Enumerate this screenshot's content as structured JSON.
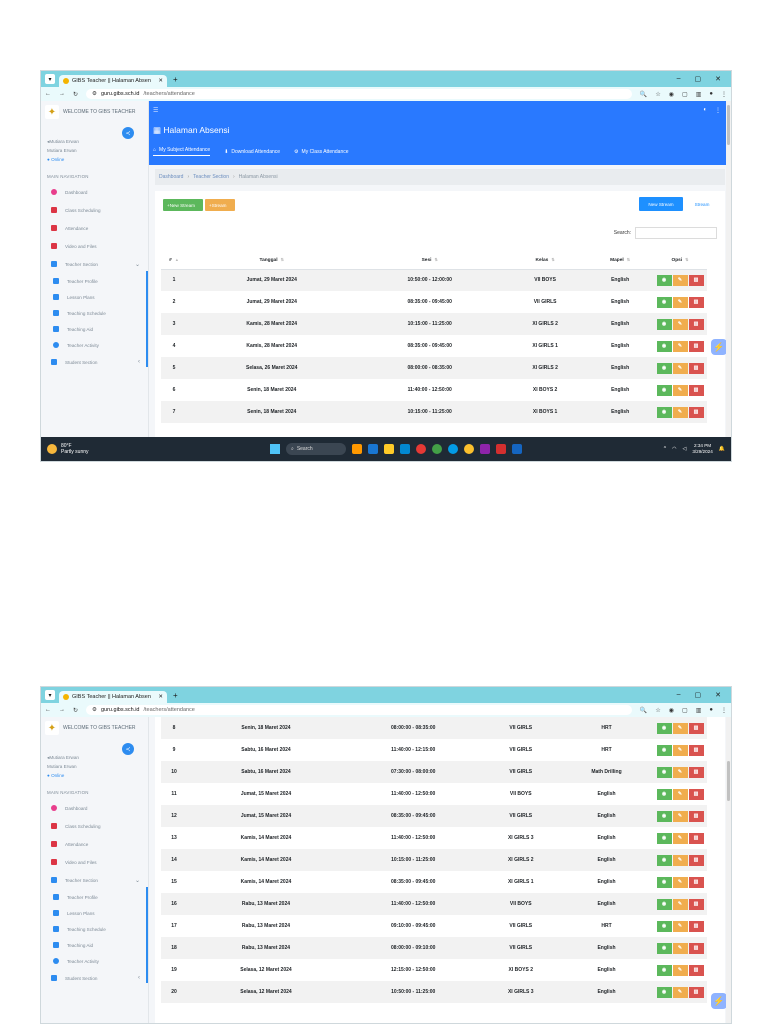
{
  "browser": {
    "tab_title": "GIBS Teacher || Halaman Absen",
    "url_host": "guru.gibs.sch.id",
    "url_path": "/teachers/attendance"
  },
  "sidebar": {
    "brand": "WELCOME TO GIBS TEACHER",
    "user_image_alt": "Mutiara Erwan",
    "user_name": "Mutiara Erwan",
    "status": "Online",
    "section_header": "MAIN NAVIGATION",
    "items": [
      {
        "label": "Dashboard",
        "color": "#e83e8c"
      },
      {
        "label": "Class Scheduling",
        "color": "#dc3545"
      },
      {
        "label": "Attendance",
        "color": "#dc3545"
      },
      {
        "label": "Video and Files",
        "color": "#dc3545"
      },
      {
        "label": "Teacher Section",
        "color": "#2d8cf0"
      },
      {
        "label": "Teacher Profile",
        "color": "#2d8cf0"
      },
      {
        "label": "Lesson Plans",
        "color": "#2d8cf0"
      },
      {
        "label": "Teaching Schedule",
        "color": "#2d8cf0"
      },
      {
        "label": "Teaching Aid",
        "color": "#2d8cf0"
      },
      {
        "label": "Teacher Activity",
        "color": "#2d8cf0"
      },
      {
        "label": "Student Section",
        "color": "#2d8cf0"
      }
    ]
  },
  "header": {
    "title": "Halaman Absensi",
    "tabs": [
      "My Subject Attendance",
      "Download Attendance",
      "My Class Attendance"
    ]
  },
  "breadcrumb": [
    "Dashboard",
    "Teacher Section",
    "Halaman Absensi"
  ],
  "buttons": {
    "new_stream_small": "New Stream",
    "stream_small": "Stream",
    "new_stream": "New Stream",
    "stream": "Stream"
  },
  "search_label": "Search:",
  "table": {
    "columns": [
      "#",
      "Tanggal",
      "Sesi",
      "Kelas",
      "Mapel",
      "Opsi"
    ],
    "rows": [
      {
        "no": "1",
        "tanggal": "Jumat, 29 Maret 2024",
        "sesi": "10:50:00 - 12:00:00",
        "kelas": "VII BOYS",
        "mapel": "English"
      },
      {
        "no": "2",
        "tanggal": "Jumat, 29 Maret 2024",
        "sesi": "08:35:00 - 09:45:00",
        "kelas": "VII GIRLS",
        "mapel": "English"
      },
      {
        "no": "3",
        "tanggal": "Kamis, 28 Maret 2024",
        "sesi": "10:15:00 - 11:25:00",
        "kelas": "XI GIRLS 2",
        "mapel": "English"
      },
      {
        "no": "4",
        "tanggal": "Kamis, 28 Maret 2024",
        "sesi": "08:35:00 - 09:45:00",
        "kelas": "XI GIRLS 1",
        "mapel": "English"
      },
      {
        "no": "5",
        "tanggal": "Selasa, 26 Maret 2024",
        "sesi": "08:00:00 - 08:35:00",
        "kelas": "XI GIRLS 2",
        "mapel": "English"
      },
      {
        "no": "6",
        "tanggal": "Senin, 18 Maret 2024",
        "sesi": "11:40:00 - 12:50:00",
        "kelas": "XI BOYS 2",
        "mapel": "English"
      },
      {
        "no": "7",
        "tanggal": "Senin, 18 Maret 2024",
        "sesi": "10:15:00 - 11:25:00",
        "kelas": "XI BOYS 1",
        "mapel": "English"
      }
    ],
    "rows_page2": [
      {
        "no": "8",
        "tanggal": "Senin, 18 Maret 2024",
        "sesi": "08:00:00 - 08:35:00",
        "kelas": "VII GIRLS",
        "mapel": "HRT"
      },
      {
        "no": "9",
        "tanggal": "Sabtu, 16 Maret 2024",
        "sesi": "11:40:00 - 12:15:00",
        "kelas": "VII GIRLS",
        "mapel": "HRT"
      },
      {
        "no": "10",
        "tanggal": "Sabtu, 16 Maret 2024",
        "sesi": "07:30:00 - 08:00:00",
        "kelas": "VII GIRLS",
        "mapel": "Math Drilling"
      },
      {
        "no": "11",
        "tanggal": "Jumat, 15 Maret 2024",
        "sesi": "11:40:00 - 12:50:00",
        "kelas": "VII BOYS",
        "mapel": "English"
      },
      {
        "no": "12",
        "tanggal": "Jumat, 15 Maret 2024",
        "sesi": "08:35:00 - 09:45:00",
        "kelas": "VII GIRLS",
        "mapel": "English"
      },
      {
        "no": "13",
        "tanggal": "Kamis, 14 Maret 2024",
        "sesi": "11:40:00 - 12:50:00",
        "kelas": "XI GIRLS 3",
        "mapel": "English"
      },
      {
        "no": "14",
        "tanggal": "Kamis, 14 Maret 2024",
        "sesi": "10:15:00 - 11:25:00",
        "kelas": "XI GIRLS 2",
        "mapel": "English"
      },
      {
        "no": "15",
        "tanggal": "Kamis, 14 Maret 2024",
        "sesi": "08:35:00 - 09:45:00",
        "kelas": "XI GIRLS 1",
        "mapel": "English"
      },
      {
        "no": "16",
        "tanggal": "Rabu, 13 Maret 2024",
        "sesi": "11:40:00 - 12:50:00",
        "kelas": "VII BOYS",
        "mapel": "English"
      },
      {
        "no": "17",
        "tanggal": "Rabu, 13 Maret 2024",
        "sesi": "09:10:00 - 09:45:00",
        "kelas": "VII GIRLS",
        "mapel": "HRT"
      },
      {
        "no": "18",
        "tanggal": "Rabu, 13 Maret 2024",
        "sesi": "08:00:00 - 09:10:00",
        "kelas": "VII GIRLS",
        "mapel": "English"
      },
      {
        "no": "19",
        "tanggal": "Selasa, 12 Maret 2024",
        "sesi": "12:15:00 - 12:50:00",
        "kelas": "XI BOYS 2",
        "mapel": "English"
      },
      {
        "no": "20",
        "tanggal": "Selasa, 12 Maret 2024",
        "sesi": "10:50:00 - 11:25:00",
        "kelas": "XI GIRLS 3",
        "mapel": "English"
      }
    ]
  },
  "taskbar": {
    "temperature": "80°F",
    "weather": "Partly sunny",
    "search_placeholder": "Search",
    "time": "2:34 PM",
    "date": "3/29/2024"
  },
  "colors": {
    "header_blue": "#2979ff",
    "view_green": "#5cb85c",
    "edit_yellow": "#f0ad4e",
    "delete_red": "#d9534f"
  }
}
